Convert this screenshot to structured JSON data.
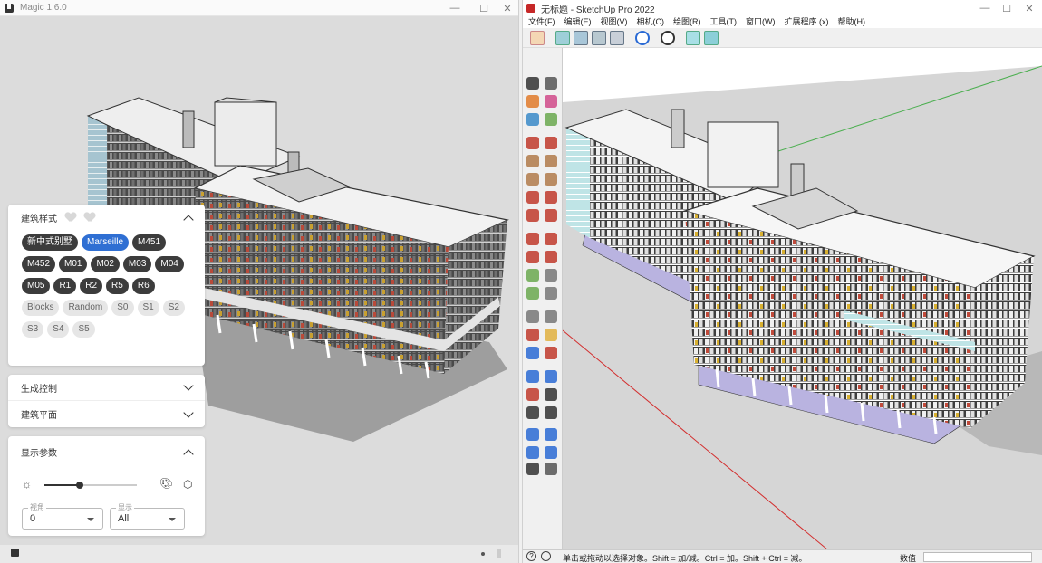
{
  "magic": {
    "window_title": "Magic 1.6.0",
    "style_panel": {
      "title": "建筑样式",
      "chips": [
        {
          "label": "新中式别墅",
          "state": "dark"
        },
        {
          "label": "Marseille",
          "state": "selected"
        },
        {
          "label": "M451",
          "state": "dark"
        },
        {
          "label": "M452",
          "state": "dark"
        },
        {
          "label": "M01",
          "state": "dark"
        },
        {
          "label": "M02",
          "state": "dark"
        },
        {
          "label": "M03",
          "state": "dark"
        },
        {
          "label": "M04",
          "state": "dark"
        },
        {
          "label": "M05",
          "state": "dark"
        },
        {
          "label": "R1",
          "state": "dark"
        },
        {
          "label": "R2",
          "state": "dark"
        },
        {
          "label": "R5",
          "state": "dark"
        },
        {
          "label": "R6",
          "state": "dark"
        },
        {
          "label": "Blocks",
          "state": "light"
        },
        {
          "label": "Random",
          "state": "light"
        },
        {
          "label": "S0",
          "state": "light"
        },
        {
          "label": "S1",
          "state": "light"
        },
        {
          "label": "S2",
          "state": "light"
        },
        {
          "label": "S3",
          "state": "light"
        },
        {
          "label": "S4",
          "state": "light"
        },
        {
          "label": "S5",
          "state": "light"
        }
      ]
    },
    "generate_panel": {
      "title": "生成控制"
    },
    "plan_panel": {
      "title": "建筑平面"
    },
    "display_panel": {
      "title": "显示参数",
      "slider_value": 0.38,
      "angle_select": {
        "label": "视角",
        "value": "0"
      },
      "display_select": {
        "label": "显示",
        "value": "All"
      }
    }
  },
  "sketchup": {
    "window_title": "无标题 - SketchUp Pro 2022",
    "menu": [
      "文件(F)",
      "编辑(E)",
      "视图(V)",
      "相机(C)",
      "绘图(R)",
      "工具(T)",
      "窗口(W)",
      "扩展程序 (x)",
      "帮助(H)"
    ],
    "status_text": "单击或拖动以选择对象。Shift = 加/减。Ctrl = 加。Shift + Ctrl = 减。",
    "measure_label": "数值"
  },
  "colors": {
    "accent": "#2f6fd3",
    "chip_dark": "#3c3c3c",
    "sketchup_ground": "#d6d6d6",
    "sketchup_sky": "#ffffff"
  }
}
